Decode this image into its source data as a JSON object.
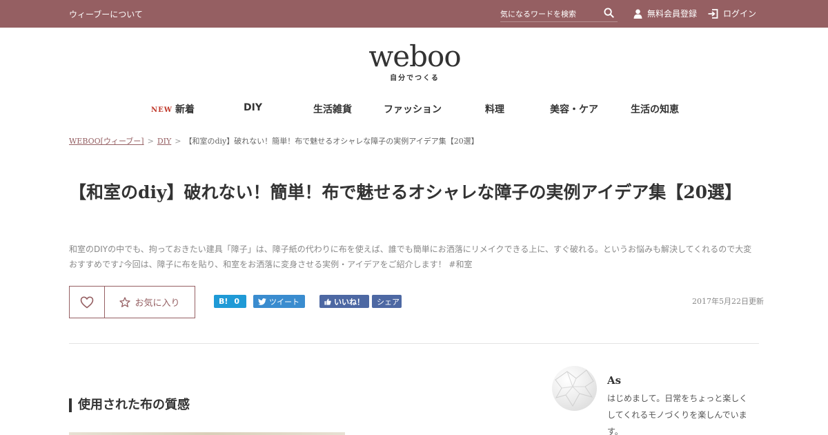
{
  "topbar": {
    "about": "ウィーブーについて",
    "search_placeholder": "気になるワードを検索",
    "register": "無料会員登録",
    "login": "ログイン"
  },
  "logo": {
    "wordmark": "weboo",
    "tagline": "自分でつくる"
  },
  "nav": {
    "new_badge": "NEW",
    "items": [
      "新着",
      "DIY",
      "生活雑貨",
      "ファッション",
      "料理",
      "美容・ケア",
      "生活の知恵"
    ]
  },
  "breadcrumb": {
    "home": "WEBOO[ウィーブー]",
    "category": "DIY",
    "current": "【和室のdiy】破れない！簡単！布で魅せるオシャレな障子の実例アイデア集【20選】",
    "separator": ">"
  },
  "article": {
    "title": "【和室のdiy】破れない！簡単！布で魅せるオシャレな障子の実例アイデア集【20選】",
    "lead": "和室のDIYの中でも、拘っておきたい建具「障子」は、障子紙の代わりに布を使えば、誰でも簡単にお洒落にリメイクできる上に、すぐ破れる。というお悩みも解決してくれるので大変おすすめです♪今回は、障子に布を貼り、和室をお洒落に変身させる実例・アイデアをご紹介します！ #和室",
    "updated": "2017年5月22日更新",
    "section_heading": "使用された布の質感"
  },
  "actions": {
    "favorite_label": "お気に入り",
    "hatena_label": "B!",
    "hatena_count": "0",
    "tweet_label": "ツイート",
    "fb_like_label": "いいね！",
    "fb_share_label": "シェア"
  },
  "author": {
    "name": "As",
    "bio": "はじめまして。日常をちょっと楽しくしてくれるモノづくりを楽しんでいます。"
  },
  "colors": {
    "brand": "#955f62",
    "hatena": "#1f9ad6",
    "twitter": "#3a8ccf",
    "facebook": "#4d68a3",
    "new_badge": "#c0392b"
  }
}
